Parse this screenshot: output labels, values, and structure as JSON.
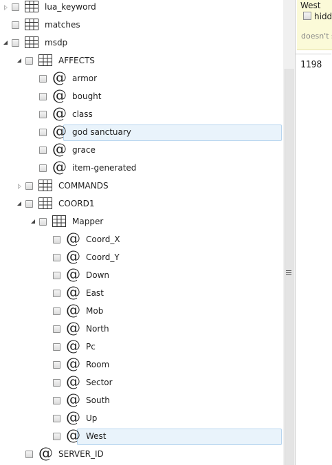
{
  "tree": [
    {
      "label": "lua_keyword",
      "icon": "table",
      "level": 0,
      "toggle": "collapsed"
    },
    {
      "label": "matches",
      "icon": "table",
      "level": 0,
      "toggle": "none"
    },
    {
      "label": "msdp",
      "icon": "table",
      "level": 0,
      "toggle": "expanded"
    },
    {
      "label": "AFFECTS",
      "icon": "table",
      "level": 1,
      "toggle": "expanded"
    },
    {
      "label": "armor",
      "icon": "at",
      "level": 2,
      "toggle": "none"
    },
    {
      "label": "bought",
      "icon": "at",
      "level": 2,
      "toggle": "none"
    },
    {
      "label": "class",
      "icon": "at",
      "level": 2,
      "toggle": "none"
    },
    {
      "label": "god sanctuary",
      "icon": "at",
      "level": 2,
      "toggle": "none",
      "selected": true
    },
    {
      "label": "grace",
      "icon": "at",
      "level": 2,
      "toggle": "none"
    },
    {
      "label": "item-generated",
      "icon": "at",
      "level": 2,
      "toggle": "none"
    },
    {
      "label": "COMMANDS",
      "icon": "table",
      "level": 1,
      "toggle": "collapsed"
    },
    {
      "label": "COORD1",
      "icon": "table",
      "level": 1,
      "toggle": "expanded"
    },
    {
      "label": "Mapper",
      "icon": "table",
      "level": 2,
      "toggle": "expanded"
    },
    {
      "label": "Coord_X",
      "icon": "at",
      "level": 3,
      "toggle": "none"
    },
    {
      "label": "Coord_Y",
      "icon": "at",
      "level": 3,
      "toggle": "none"
    },
    {
      "label": "Down",
      "icon": "at",
      "level": 3,
      "toggle": "none"
    },
    {
      "label": "East",
      "icon": "at",
      "level": 3,
      "toggle": "none"
    },
    {
      "label": "Mob",
      "icon": "at",
      "level": 3,
      "toggle": "none"
    },
    {
      "label": "North",
      "icon": "at",
      "level": 3,
      "toggle": "none"
    },
    {
      "label": "Pc",
      "icon": "at",
      "level": 3,
      "toggle": "none"
    },
    {
      "label": "Room",
      "icon": "at",
      "level": 3,
      "toggle": "none"
    },
    {
      "label": "Sector",
      "icon": "at",
      "level": 3,
      "toggle": "none"
    },
    {
      "label": "South",
      "icon": "at",
      "level": 3,
      "toggle": "none"
    },
    {
      "label": "Up",
      "icon": "at",
      "level": 3,
      "toggle": "none"
    },
    {
      "label": "West",
      "icon": "at",
      "level": 3,
      "toggle": "none",
      "selected": true
    },
    {
      "label": "SERVER_ID",
      "icon": "at",
      "level": 1,
      "toggle": "none"
    }
  ],
  "details": {
    "name": "West",
    "hidden_label": "hidden",
    "description": "doesn't show",
    "value": "1198"
  },
  "colors": {
    "selection_bg": "#e9f3fb",
    "selection_border": "#b7d5ef",
    "note_bg": "#fbfad8"
  }
}
